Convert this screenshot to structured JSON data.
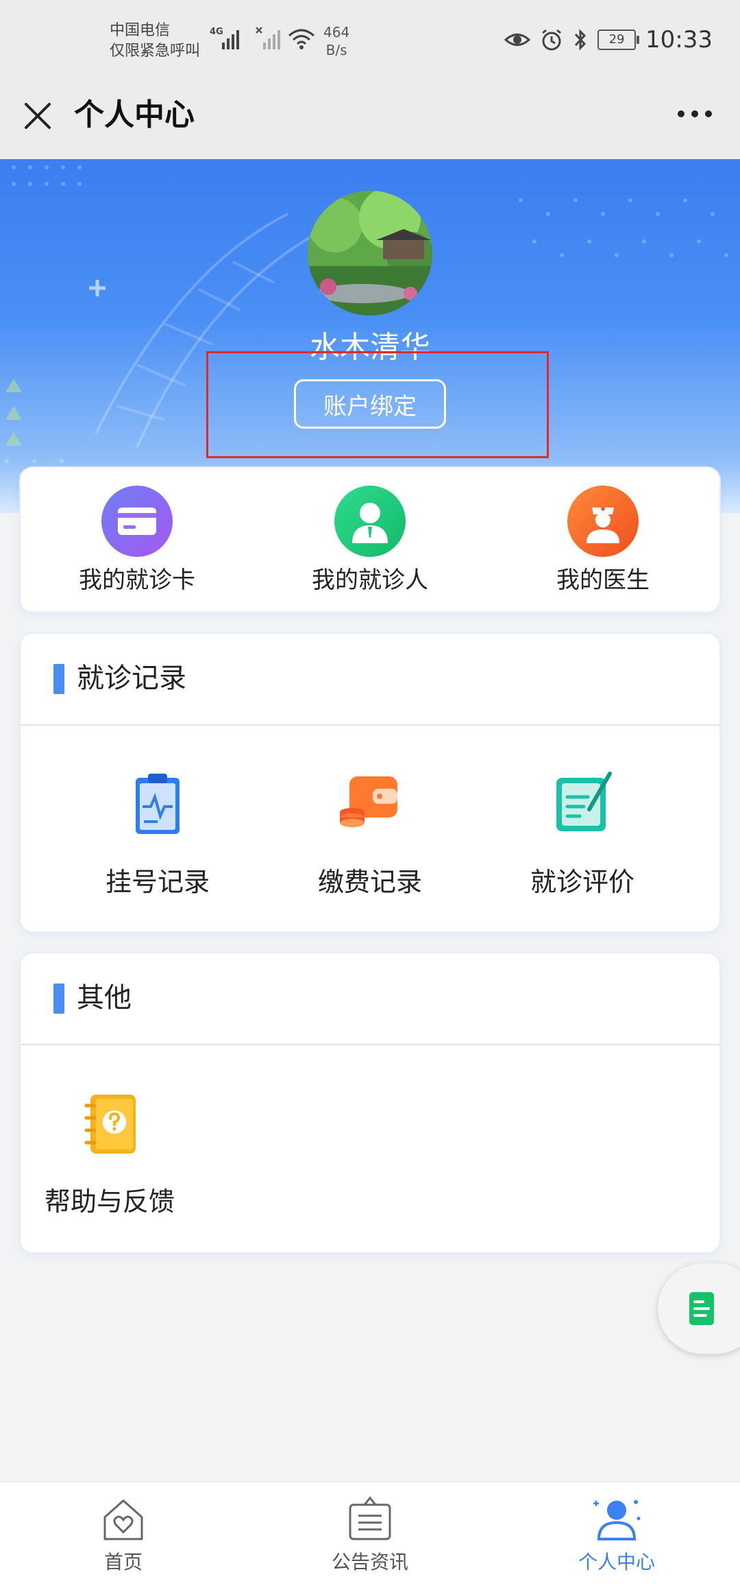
{
  "status_bar": {
    "carrier_line1": "中国电信",
    "carrier_line2": "仅限紧急呼叫",
    "net_type": "4G",
    "net_speed_value": "464",
    "net_speed_unit": "B/s",
    "battery": "29",
    "time": "10:33"
  },
  "nav": {
    "title": "个人中心"
  },
  "profile": {
    "name": "水木清华",
    "bind_button": "账户绑定"
  },
  "quick_links": [
    {
      "label": "我的就诊卡",
      "icon": "card-icon",
      "color": "#8c5cf5"
    },
    {
      "label": "我的就诊人",
      "icon": "patient-icon",
      "color": "#1ec97a"
    },
    {
      "label": "我的医生",
      "icon": "doctor-icon",
      "color": "#f06a2a"
    }
  ],
  "records": {
    "title": "就诊记录",
    "items": [
      {
        "label": "挂号记录",
        "icon": "clipboard-icon"
      },
      {
        "label": "缴费记录",
        "icon": "wallet-icon"
      },
      {
        "label": "就诊评价",
        "icon": "review-icon"
      }
    ]
  },
  "others": {
    "title": "其他",
    "items": [
      {
        "label": "帮助与反馈",
        "icon": "help-book-icon"
      }
    ]
  },
  "tabs": [
    {
      "label": "首页",
      "icon": "home-icon",
      "active": false
    },
    {
      "label": "公告资讯",
      "icon": "notice-icon",
      "active": false
    },
    {
      "label": "个人中心",
      "icon": "profile-icon",
      "active": true
    }
  ],
  "colors": {
    "accent": "#3b82f0",
    "highlight_box": "#e02a2a"
  }
}
